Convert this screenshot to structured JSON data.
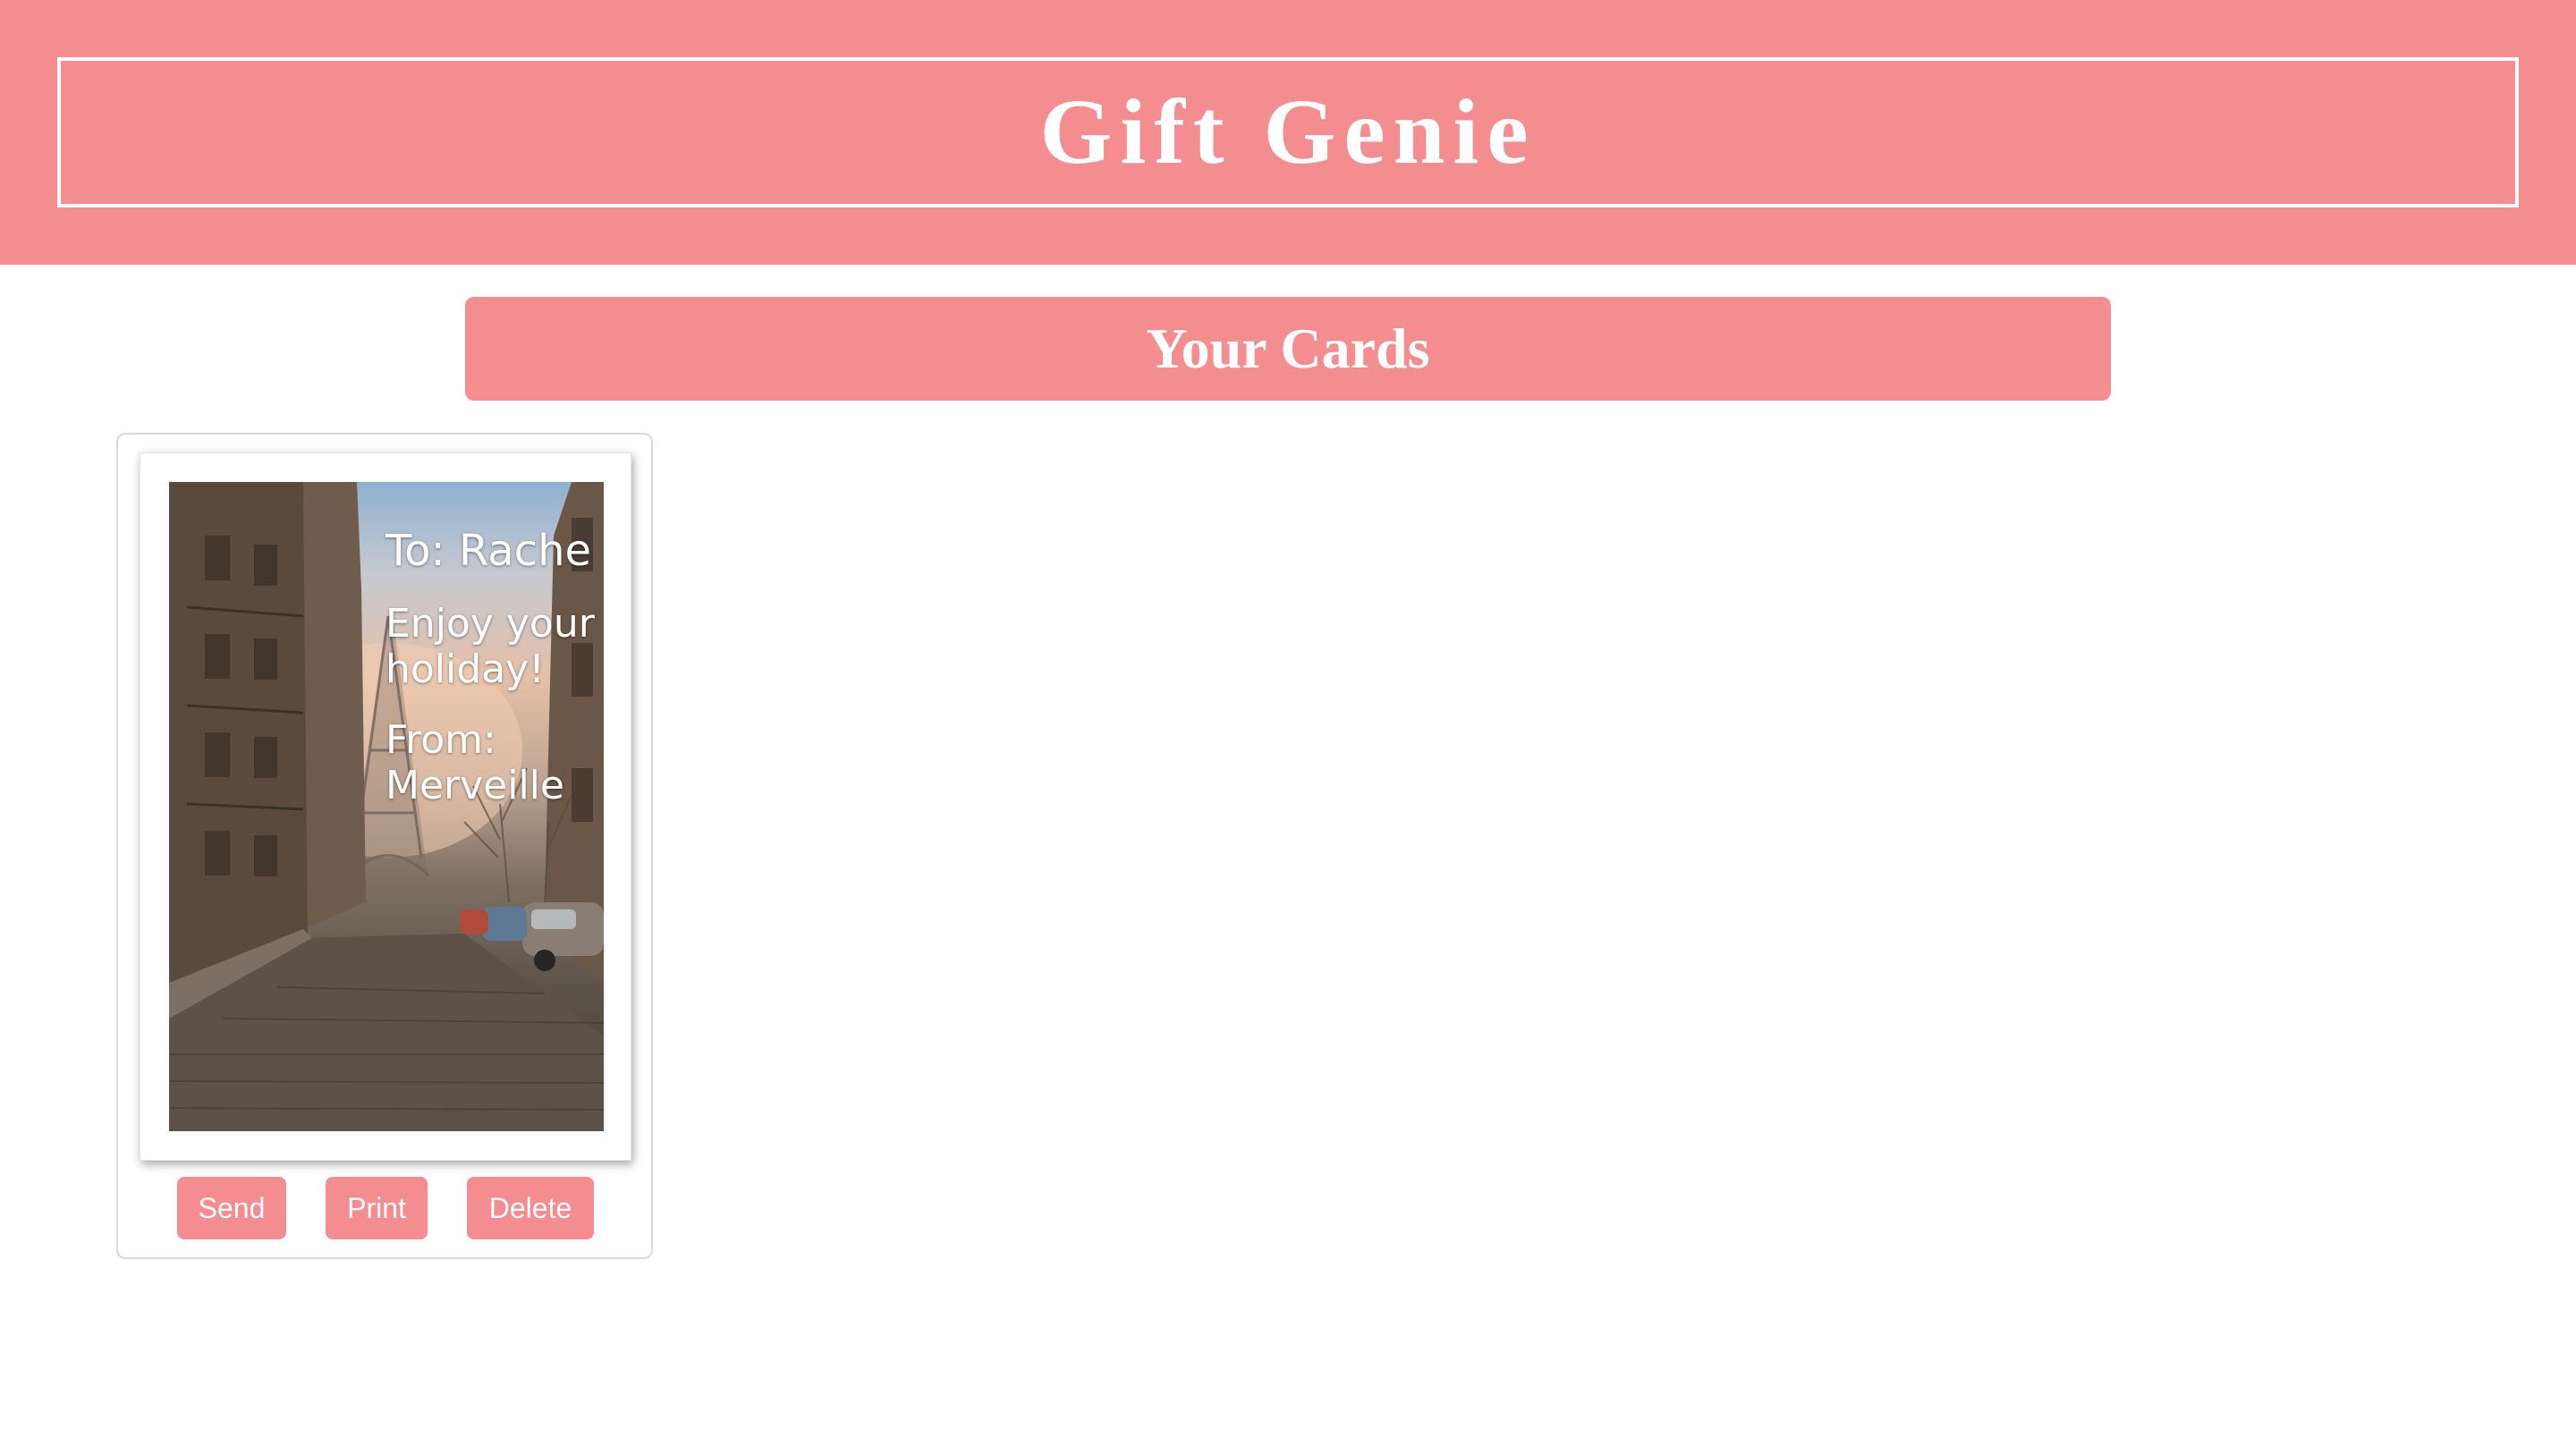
{
  "header": {
    "title": "Gift Genie"
  },
  "section": {
    "title": "Your Cards"
  },
  "cards": [
    {
      "image": "eiffel-tower-street-photo",
      "to": "To: Rache",
      "message": "Enjoy your holiday!",
      "from": "From: Merveille",
      "actions": {
        "send": "Send",
        "print": "Print",
        "delete": "Delete"
      }
    }
  ],
  "colors": {
    "accent": "#f48d8f",
    "text_on_accent": "#ffffff",
    "tile_border": "#d9d9d9"
  }
}
